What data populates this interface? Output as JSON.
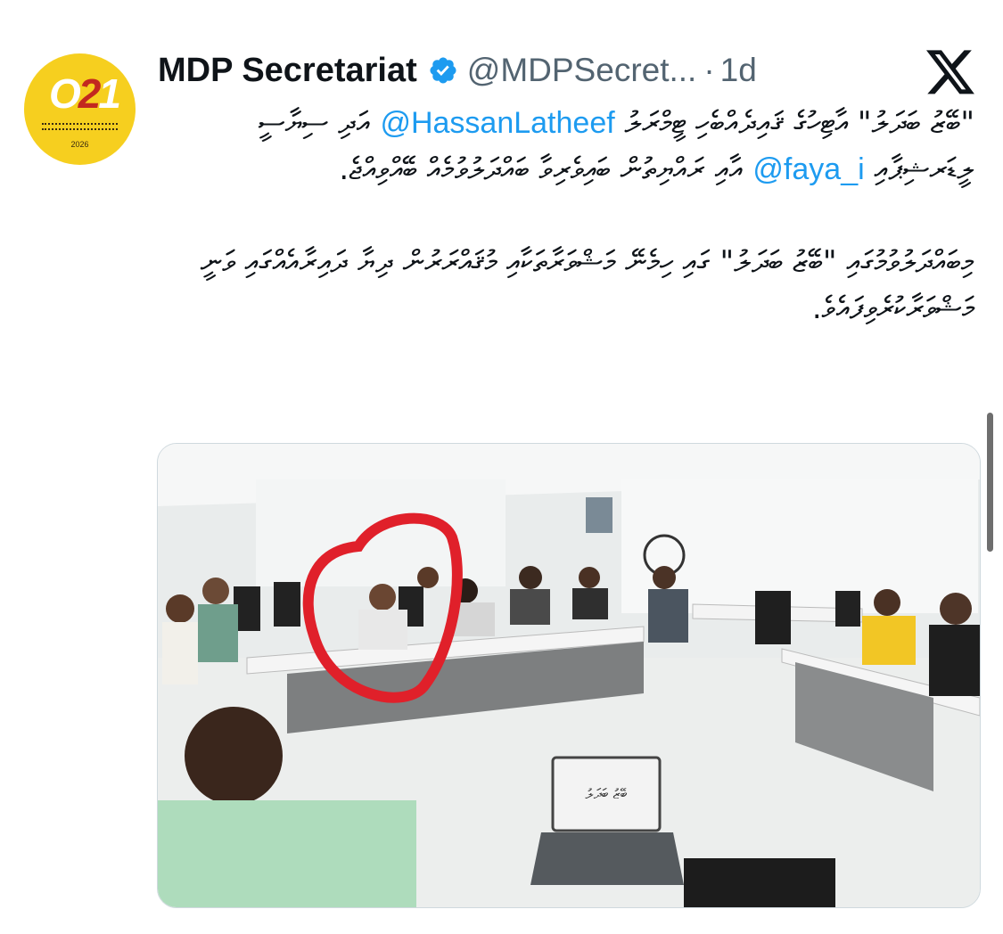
{
  "author": {
    "avatar_label": "021",
    "avatar_year": "2026",
    "name": "MDP Secretariat",
    "handle": "@MDPSecret...",
    "separator": "·",
    "time": "1d"
  },
  "tweet": {
    "line1_before": "\"ބޭޒު ބަދަލު\" އާޓިހުގެ ޤައިދެއްބެހި ޓީމްރަލު ",
    "mention1": "@HassanLatheef",
    "line2_before": "އަދި ސިޔާސީ ލީޑަރޝިޕާއި ",
    "mention2": "@faya_i",
    "line2_after": " އާއި ރައްޔިތުން ބައިވެރިވާ ބައްދަލުވުމެއް ބޭއްވިއްޖެ.",
    "paragraph2": "މިބައްދަލުވުމުގައި \"ބޭޒު ބަދަލު\" ގައި ހިމެނޭ މަޝްވަރާތަކާއި މުޤައްރަރުން ދިޔާ ދައިރާއެއްގައި ވަނީ މަޝްވަރާކުރެވިފައެވެ."
  },
  "media": {
    "alt": "Meeting photo with participants seated around tables",
    "laptop_text": "ބޭޒު ބަދަލު",
    "highlight_color": "#e0202a"
  },
  "colors": {
    "accent": "#1d9bf0",
    "avatar_bg": "#f6cf1f",
    "secondary_text": "#536471"
  },
  "icons": {
    "verified": "verified-badge-icon",
    "platform": "x-logo-icon"
  }
}
